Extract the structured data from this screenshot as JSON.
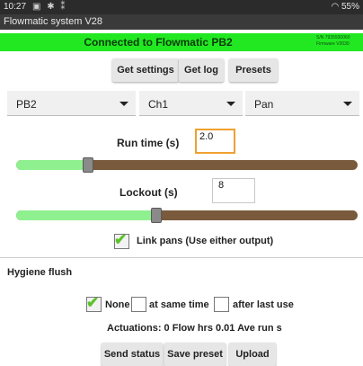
{
  "status_bar": {
    "time": "10:27",
    "icons": "▣ ✱ ⁑",
    "battery": "55%"
  },
  "app": {
    "title": "Flowmatic system V28"
  },
  "connection": {
    "text": "Connected to Flowmatic PB2",
    "serial": "S/N 7935930060",
    "firmware": "Firmware V3030"
  },
  "toolbar": {
    "get_settings": "Get settings",
    "get_log": "Get log",
    "presets": "Presets"
  },
  "selectors": {
    "device": "PB2",
    "channel": "Ch1",
    "mode": "Pan"
  },
  "run_time": {
    "label": "Run time (s)",
    "value": "2.0",
    "slider_fraction": 0.21
  },
  "lockout": {
    "label": "Lockout (s)",
    "value": "8",
    "slider_fraction": 0.41
  },
  "link_pans": {
    "label": "Link pans (Use either output)",
    "checked": true
  },
  "hygiene": {
    "title": "Hygiene flush",
    "options": [
      {
        "label": "None",
        "checked": true
      },
      {
        "label": "at same time",
        "checked": false
      },
      {
        "label": "after last use",
        "checked": false
      }
    ]
  },
  "stats": {
    "text": "Actuations: 0  Flow hrs 0.01  Ave run  s"
  },
  "actions": {
    "send_status": "Send status",
    "save_preset": "Save preset",
    "upload": "Upload"
  },
  "colors": {
    "connected_green": "#22e822",
    "slider_fill": "#8ff08f",
    "slider_track": "#7a5a3c",
    "check_green": "#5cc22c"
  }
}
